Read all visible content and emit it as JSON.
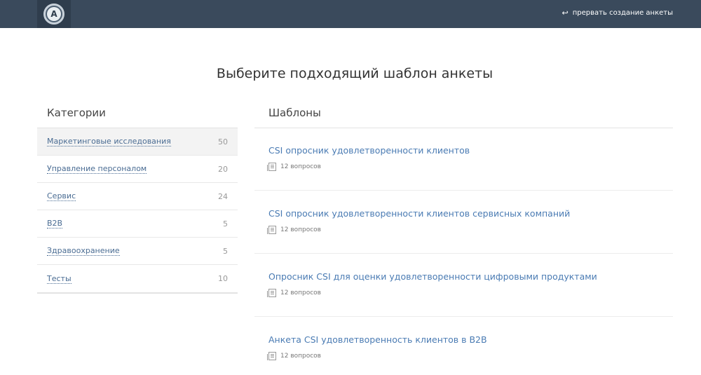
{
  "header": {
    "logo_letter": "A",
    "exit_label": "прервать создание анкеты"
  },
  "page": {
    "title": "Выберите подходящий шаблон анкеты"
  },
  "categories": {
    "heading": "Категории",
    "items": [
      {
        "label": "Маркетинговые исследования",
        "count": "50",
        "active": true
      },
      {
        "label": "Управление персоналом",
        "count": "20",
        "active": false
      },
      {
        "label": "Сервис",
        "count": "24",
        "active": false
      },
      {
        "label": "B2B",
        "count": "5",
        "active": false
      },
      {
        "label": "Здравоохранение",
        "count": "5",
        "active": false
      },
      {
        "label": "Тесты",
        "count": "10",
        "active": false
      }
    ]
  },
  "templates": {
    "heading": "Шаблоны",
    "items": [
      {
        "title": "CSI опросник удовлетворенности клиентов",
        "questions": "12 вопросов"
      },
      {
        "title": "CSI опросник удовлетворенности клиентов сервисных компаний",
        "questions": "12 вопросов"
      },
      {
        "title": "Опросник CSI для оценки удовлетворенности цифровыми продуктами",
        "questions": "12 вопросов"
      },
      {
        "title": "Анкета CSI удовлетворенность клиентов в B2B",
        "questions": "12 вопросов"
      }
    ]
  },
  "colors": {
    "topbar": "#3a4a5c",
    "link": "#4a7bb3"
  },
  "icons": {
    "logo": "logo-icon",
    "exit": "return-arrow-icon",
    "questions": "document-icon"
  }
}
